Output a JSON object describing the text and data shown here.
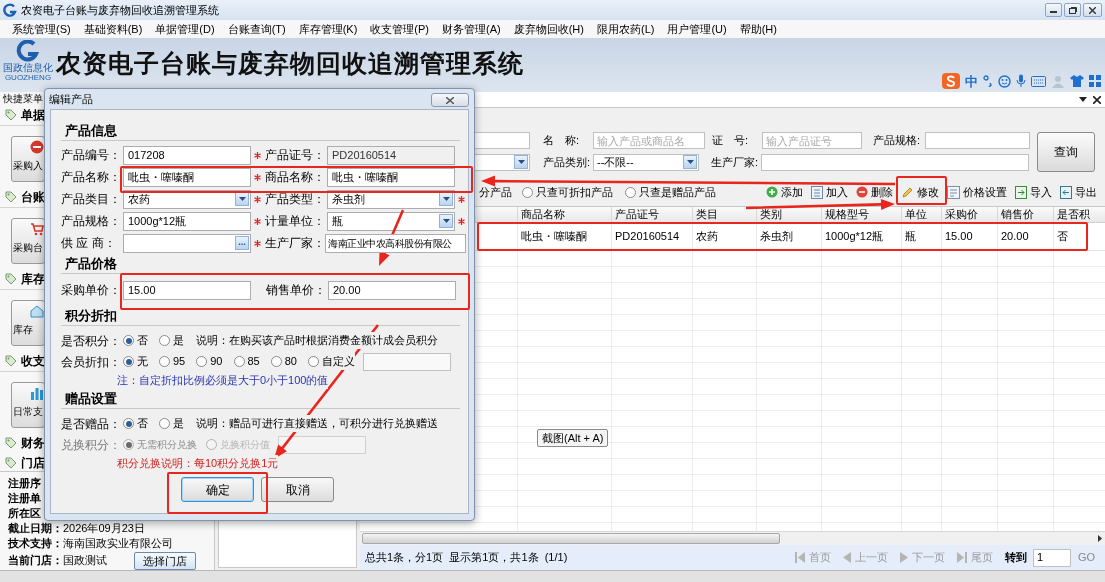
{
  "window": {
    "title": "农资电子台账与废弃物回收追溯管理系统"
  },
  "menu": [
    "系统管理(S)",
    "基础资料(B)",
    "单据管理(D)",
    "台账查询(T)",
    "库存管理(K)",
    "收支管理(P)",
    "财务管理(A)",
    "废弃物回收(H)",
    "限用农药(L)",
    "用户管理(U)",
    "帮助(H)"
  ],
  "header": {
    "logo_text": "国政信息化",
    "logo_subtext": "GUOZHENG",
    "title": "农资电子台账与废弃物回收追溯管理系统",
    "ime_mode": "中"
  },
  "sidebar": {
    "title": "快捷菜单",
    "groups": [
      {
        "label": "单据",
        "button": "采购入",
        "kind": "receipt"
      },
      {
        "label": "台账",
        "button": "采购台",
        "kind": "cart"
      },
      {
        "label": "库存",
        "button": "库存",
        "kind": "house"
      },
      {
        "label": "收支",
        "button": "日常支",
        "kind": "bars"
      }
    ],
    "links": [
      "财务",
      "门店"
    ],
    "info": [
      {
        "label": "注册序"
      },
      {
        "label": "注册单"
      },
      {
        "label": "所在区"
      },
      {
        "label": "截止日期：",
        "value": "2026年09月23日"
      },
      {
        "label": "技术支持：",
        "value": "海南国政实业有限公司"
      },
      {
        "label": "当前门店：",
        "value": "国政测试"
      }
    ],
    "store_button": "选择门店"
  },
  "filter": {
    "name": {
      "label": "名　称:",
      "placeholder": "输入产品或商品名"
    },
    "cert": {
      "label": "证　号:",
      "placeholder": "输入产品证号"
    },
    "spec": {
      "label": "产品规格:"
    },
    "category": {
      "label": "产品类别:",
      "value": "--不限--"
    },
    "maker": {
      "label": "生产厂家:"
    },
    "query_button": "查询"
  },
  "toolbar": {
    "cut_label": "分产品",
    "options": [
      {
        "label": "只查可折扣产品",
        "selected": false
      },
      {
        "label": "只查是赠品产品",
        "selected": false
      }
    ],
    "actions": [
      {
        "label": "添加",
        "kind": "add"
      },
      {
        "label": "加入",
        "kind": "list"
      },
      {
        "label": "删除",
        "kind": "delete"
      },
      {
        "label": "修改",
        "kind": "edit"
      },
      {
        "label": "价格设置",
        "kind": "settings"
      },
      {
        "label": "导入",
        "kind": "import"
      },
      {
        "label": "导出",
        "kind": "export"
      }
    ]
  },
  "table": {
    "columns": [
      "商品名称",
      "产品证号",
      "类目",
      "类别",
      "规格型号",
      "单位",
      "采购价",
      "销售价",
      "是否积"
    ],
    "rows": [
      [
        "吡虫・噻嗪酮",
        "PD20160514",
        "农药",
        "杀虫剂",
        "1000g*12瓶",
        "瓶",
        "15.00",
        "20.00",
        "否"
      ]
    ]
  },
  "status_bar": {
    "summary": "总共1条，分1页  显示第1页，共1条  (1/1)",
    "pager": [
      {
        "label": "首页",
        "kind": "first",
        "disabled": true
      },
      {
        "label": "上一页",
        "kind": "prev",
        "disabled": true
      },
      {
        "label": "下一页",
        "kind": "next",
        "disabled": true
      },
      {
        "label": "尾页",
        "kind": "last",
        "disabled": true
      }
    ],
    "goto_label": "转到",
    "goto_value": "1",
    "go": "GO"
  },
  "tooltip": "截图(Alt + A)",
  "dialog": {
    "title": "编辑产品",
    "info": {
      "heading": "产品信息",
      "fields": [
        {
          "label": "产品编号：",
          "value": "017208",
          "kind": "text",
          "required": true
        },
        {
          "label": "产品证号：",
          "value": "PD20160514",
          "kind": "readonly",
          "required": false
        },
        {
          "label": "产品名称：",
          "value": "吡虫・噻嗪酮",
          "kind": "text",
          "required": true
        },
        {
          "label": "商品名称：",
          "value": "吡虫・噻嗪酮",
          "kind": "text",
          "required": false
        },
        {
          "label": "产品类目：",
          "value": "农药",
          "kind": "select",
          "required": true
        },
        {
          "label": "产品类型：",
          "value": "杀虫剂",
          "kind": "select",
          "required": true
        },
        {
          "label": "产品规格：",
          "value": "1000g*12瓶",
          "kind": "text",
          "required": true
        },
        {
          "label": "计量单位：",
          "value": "瓶",
          "kind": "select",
          "required": true
        },
        {
          "label": "供 应 商：",
          "kind": "picker",
          "button": "...",
          "required": true
        },
        {
          "label": "生产厂家：",
          "value": "海南正业中农高科股份有限公",
          "kind": "text",
          "required": false
        }
      ]
    },
    "price": {
      "heading": "产品价格",
      "fields": [
        {
          "label": "采购单价：",
          "value": "15.00"
        },
        {
          "label": "销售单价：",
          "value": "20.00"
        }
      ]
    },
    "points": {
      "heading": "积分折扣",
      "rows": [
        {
          "label": "是否积分：",
          "disabled": false,
          "has_field": false,
          "options": [
            {
              "label": "否",
              "selected": true
            },
            {
              "label": "是",
              "selected": false
            }
          ],
          "note": "说明：在购买该产品时根据消费金额计成会员积分"
        },
        {
          "label": "会员折扣：",
          "disabled": false,
          "has_field": true,
          "options": [
            {
              "label": "无",
              "selected": true
            },
            {
              "label": "95",
              "selected": false
            },
            {
              "label": "90",
              "selected": false
            },
            {
              "label": "85",
              "selected": false
            },
            {
              "label": "80",
              "selected": false
            },
            {
              "label": "自定义",
              "selected": false
            }
          ]
        }
      ],
      "hint": "注：自定折扣比例必须是大于0小于100的值"
    },
    "gift": {
      "heading": "赠品设置",
      "rows": [
        {
          "label": "是否赠品：",
          "disabled": false,
          "has_field": false,
          "options": [
            {
              "label": "否",
              "selected": true
            },
            {
              "label": "是",
              "selected": false
            }
          ],
          "note": "说明：赠品可进行直接赠送，可积分进行兑换赠送"
        },
        {
          "label": "兑换积分：",
          "disabled": true,
          "has_field": true,
          "options": [
            {
              "label": "无需积分兑换",
              "selected": true
            },
            {
              "label": "兑换积分值",
              "selected": false
            }
          ]
        }
      ],
      "hint": "积分兑换说明：每10积分兑换1元"
    },
    "buttons": [
      {
        "label": "确定",
        "default": true
      },
      {
        "label": "取消",
        "default": false
      }
    ]
  }
}
